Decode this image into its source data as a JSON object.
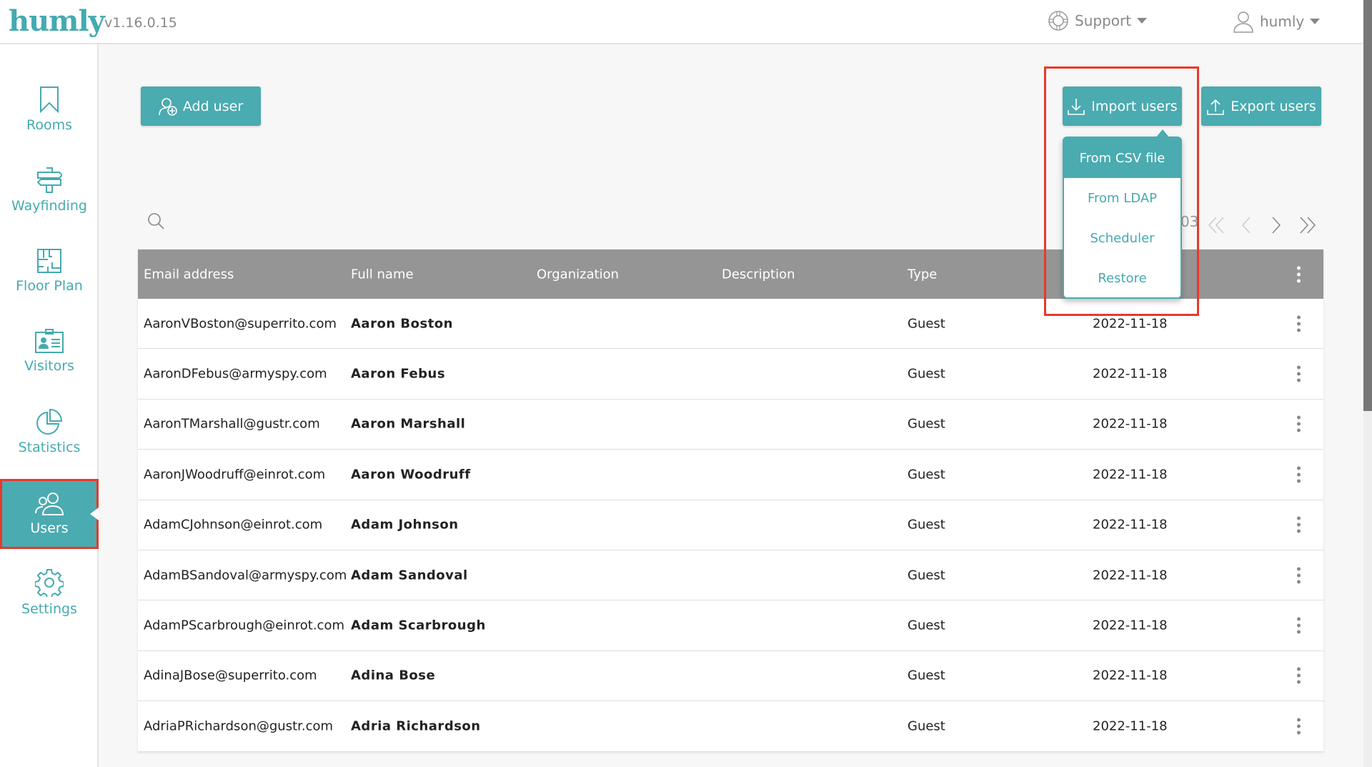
{
  "header": {
    "logo": "humly",
    "version": "v1.16.0.15",
    "support": "Support",
    "user": "humly"
  },
  "sidebar": {
    "items": [
      {
        "label": "Rooms",
        "icon": "bookmark-icon"
      },
      {
        "label": "Wayfinding",
        "icon": "signpost-icon"
      },
      {
        "label": "Floor Plan",
        "icon": "floorplan-icon"
      },
      {
        "label": "Visitors",
        "icon": "visitor-card-icon"
      },
      {
        "label": "Statistics",
        "icon": "pie-chart-icon"
      },
      {
        "label": "Users",
        "icon": "users-icon",
        "active": true
      },
      {
        "label": "Settings",
        "icon": "gear-icon"
      }
    ]
  },
  "toolbar": {
    "add_user": "Add user",
    "import_users": "Import users",
    "export_users": "Export users"
  },
  "import_menu": [
    "From CSV file",
    "From LDAP",
    "Scheduler",
    "Restore"
  ],
  "pagination": {
    "partial_text": "03"
  },
  "table": {
    "headers": [
      "Email address",
      "Full name",
      "Organization",
      "Description",
      "Type",
      ""
    ],
    "rows": [
      [
        "AaronVBoston@superrito.com",
        "Aaron Boston",
        "",
        "",
        "Guest",
        "2022-11-18"
      ],
      [
        "AaronDFebus@armyspy.com",
        "Aaron Febus",
        "",
        "",
        "Guest",
        "2022-11-18"
      ],
      [
        "AaronTMarshall@gustr.com",
        "Aaron Marshall",
        "",
        "",
        "Guest",
        "2022-11-18"
      ],
      [
        "AaronJWoodruff@einrot.com",
        "Aaron Woodruff",
        "",
        "",
        "Guest",
        "2022-11-18"
      ],
      [
        "AdamCJohnson@einrot.com",
        "Adam Johnson",
        "",
        "",
        "Guest",
        "2022-11-18"
      ],
      [
        "AdamBSandoval@armyspy.com",
        "Adam Sandoval",
        "",
        "",
        "Guest",
        "2022-11-18"
      ],
      [
        "AdamPScarbrough@einrot.com",
        "Adam Scarbrough",
        "",
        "",
        "Guest",
        "2022-11-18"
      ],
      [
        "AdinaJBose@superrito.com",
        "Adina Bose",
        "",
        "",
        "Guest",
        "2022-11-18"
      ],
      [
        "AdriaPRichardson@gustr.com",
        "Adria Richardson",
        "",
        "",
        "Guest",
        "2022-11-18"
      ]
    ]
  },
  "colors": {
    "accent": "#4aabb0",
    "highlight": "#e8392a",
    "table_header": "#959595"
  }
}
